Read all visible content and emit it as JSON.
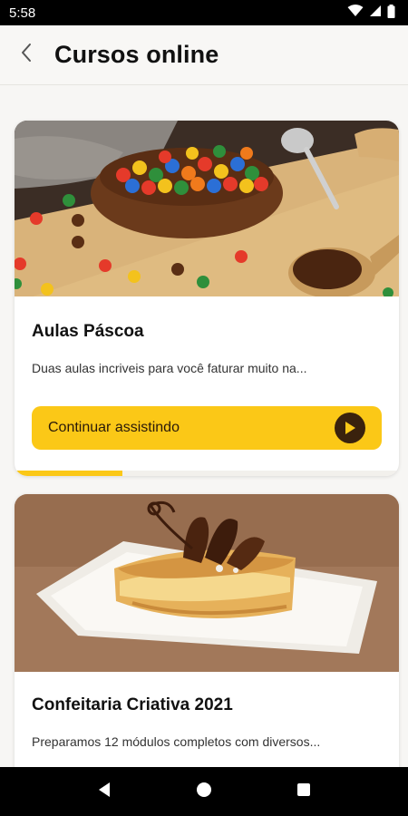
{
  "status_bar": {
    "time": "5:58",
    "icons": [
      "wifi-icon",
      "signal-icon",
      "battery-icon"
    ]
  },
  "header": {
    "back_icon": "chevron-left-icon",
    "title": "Cursos online"
  },
  "courses": [
    {
      "title": "Aulas Páscoa",
      "description": "Duas aulas incriveis para você faturar muito na...",
      "button_label": "Continuar assistindo",
      "button_icon": "play-icon",
      "progress": 0.28
    },
    {
      "title": "Confeitaria Criativa 2021",
      "description": "Preparamos 12 módulos completos com diversos..."
    }
  ],
  "nav_bar": {
    "icons": [
      "back-triangle-icon",
      "home-circle-icon",
      "recents-square-icon"
    ]
  },
  "colors": {
    "accent": "#fbc817",
    "button_icon_bg": "#3a220d",
    "status_bar": "#000000"
  }
}
